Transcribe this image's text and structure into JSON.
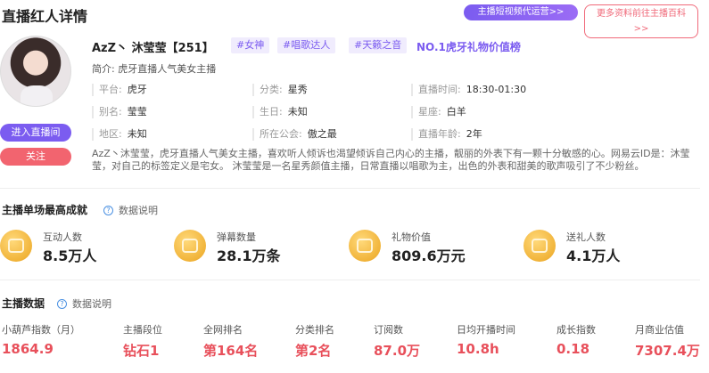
{
  "header": {
    "title": "直播红人详情",
    "promo_button": "主播短视频代运营>>",
    "more_button_line1": "更多资料前往主播百科",
    "more_button_line2": ">>"
  },
  "profile": {
    "name": "AzZ丶 沐莹莹【251】",
    "tags": [
      "#女神",
      "#唱歌达人",
      "#天籁之音"
    ],
    "rank_link": "NO.1虎牙礼物价值榜",
    "intro_label": "简介:",
    "intro": "虎牙直播人气美女主播",
    "enter_button": "进入直播间",
    "follow_button": "关注",
    "info": {
      "platform_label": "平台:",
      "platform": "虎牙",
      "category_label": "分类:",
      "category": "星秀",
      "live_time_label": "直播时间:",
      "live_time": "18:30-01:30",
      "alias_label": "别名:",
      "alias": "莹莹",
      "birthday_label": "生日:",
      "birthday": "未知",
      "zodiac_label": "星座:",
      "zodiac": "白羊",
      "region_label": "地区:",
      "region": "未知",
      "guild_label": "所在公会:",
      "guild": "傲之最",
      "live_age_label": "直播年龄:",
      "live_age": "2年"
    },
    "description": "AzZ丶沐莹莹，虎牙直播人气美女主播，喜欢听人倾诉也渴望倾诉自己内心的主播，靓丽的外表下有一颗十分敏感的心。网易云ID是：沐莹莹，对自己的标签定义是宅女。 沐莹莹是一名星秀颜值主播，日常直播以唱歌为主，出色的外表和甜美的歌声吸引了不少粉丝。"
  },
  "best_record": {
    "title": "主播单场最高成就",
    "help": "数据说明",
    "stats": [
      {
        "icon": "interaction-icon",
        "label": "互动人数",
        "value": "8.5万人"
      },
      {
        "icon": "danmaku-icon",
        "label": "弹幕数量",
        "value": "28.1万条"
      },
      {
        "icon": "gift-value-icon",
        "label": "礼物价值",
        "value": "809.6万元"
      },
      {
        "icon": "gift-sender-icon",
        "label": "送礼人数",
        "value": "4.1万人"
      }
    ]
  },
  "anchor_data": {
    "title": "主播数据",
    "help": "数据说明",
    "metrics": [
      {
        "label": "小葫芦指数（月）",
        "value": "1864.9"
      },
      {
        "label": "主播段位",
        "value": "钻石1"
      },
      {
        "label": "全网排名",
        "value": "第164名"
      },
      {
        "label": "分类排名",
        "value": "第2名"
      },
      {
        "label": "订阅数",
        "value": "87.0万"
      },
      {
        "label": "日均开播时间",
        "value": "10.8h"
      },
      {
        "label": "成长指数",
        "value": "0.18"
      },
      {
        "label": "月商业估值",
        "value": "7307.4万"
      }
    ]
  }
}
